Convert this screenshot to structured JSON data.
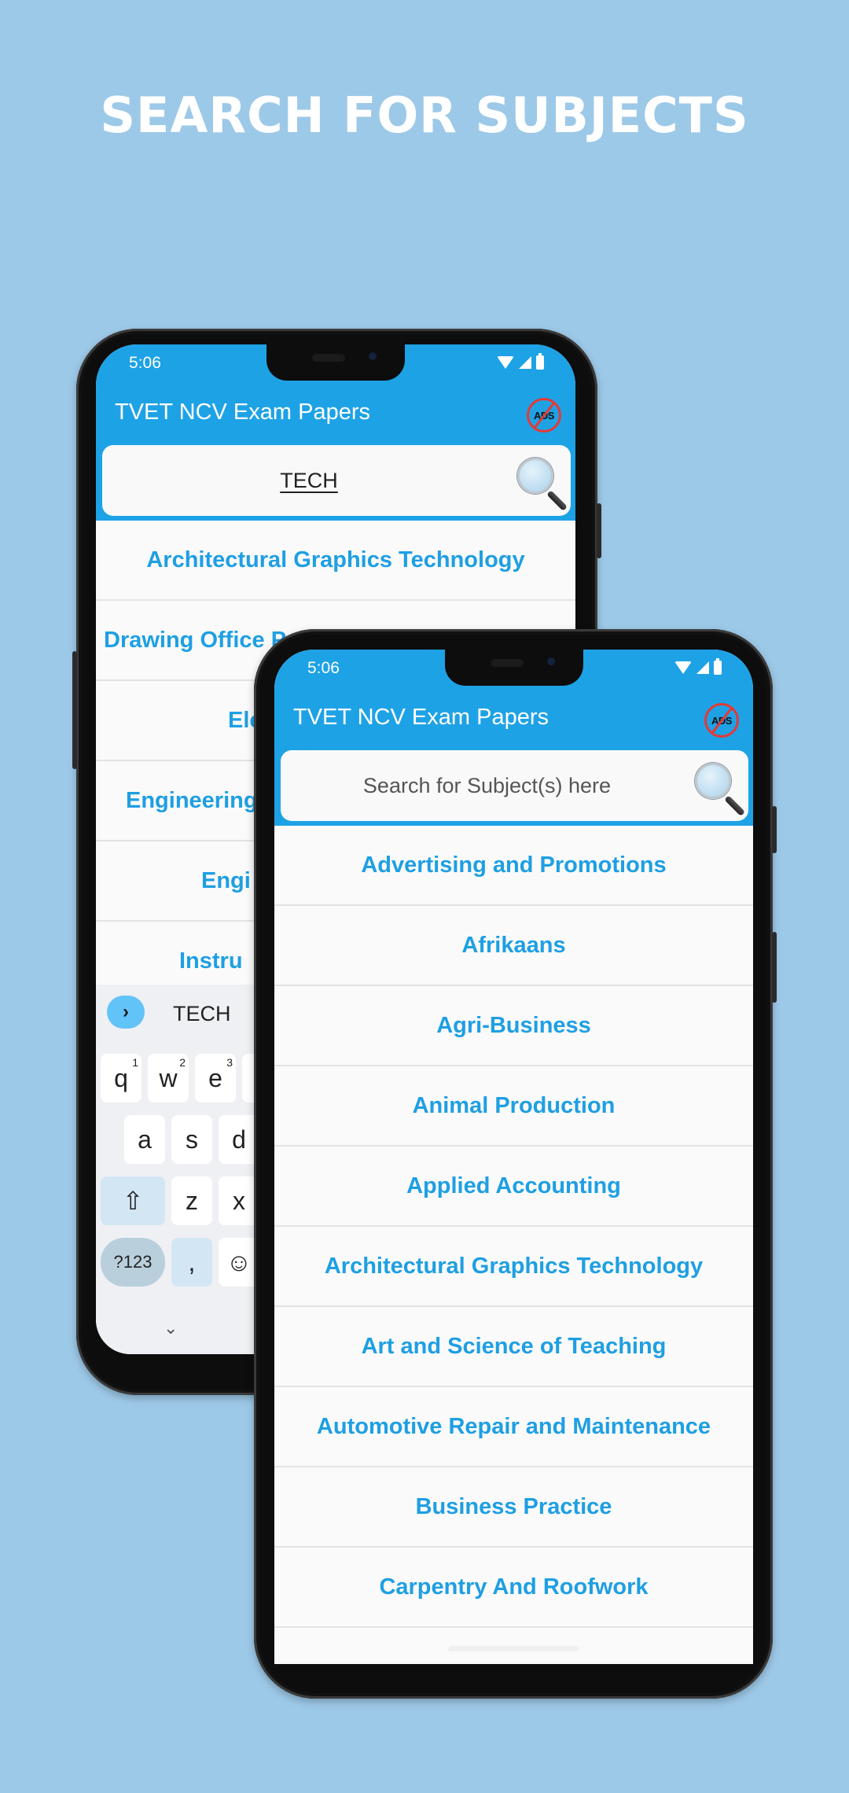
{
  "headline": "SEARCH FOR SUBJECTS",
  "colors": {
    "background": "#9dc9e8",
    "app_bar": "#1ea2e6",
    "list_text": "#1e9fe3",
    "no_ads_ring": "#e53935"
  },
  "back_phone": {
    "status": {
      "time": "5:06",
      "icons": [
        "wifi-icon",
        "signal-icon",
        "battery-icon"
      ]
    },
    "app_title": "TVET NCV Exam Papers",
    "no_ads_label": "ADS",
    "search": {
      "value": "TECH",
      "placeholder": "Search for Subject(s) here"
    },
    "results": [
      "Architectural Graphics Technology",
      "Drawing Office P",
      "Ele",
      "Engineering",
      "Engi",
      "Instru"
    ],
    "keyboard": {
      "suggestion": "TECH",
      "row1": [
        {
          "k": "q",
          "n": "1"
        },
        {
          "k": "w",
          "n": "2"
        },
        {
          "k": "e",
          "n": "3"
        }
      ],
      "row2": [
        "a",
        "s",
        "d"
      ],
      "row3": [
        "z",
        "x"
      ],
      "symbols_label": "?123",
      "comma_label": ",",
      "expand_glyph": "›",
      "hide_glyph": "⌄",
      "shift_glyph": "⇧",
      "emoji_glyph": "☺"
    }
  },
  "front_phone": {
    "status": {
      "time": "5:06",
      "icons": [
        "wifi-icon",
        "signal-icon",
        "battery-icon"
      ]
    },
    "app_title": "TVET NCV Exam Papers",
    "no_ads_label": "ADS",
    "search": {
      "value": "",
      "placeholder": "Search for Subject(s) here"
    },
    "subjects": [
      "Advertising and Promotions",
      "Afrikaans",
      "Agri-Business",
      "Animal Production",
      "Applied Accounting",
      "Architectural Graphics Technology",
      "Art and Science of Teaching",
      "Automotive Repair and Maintenance",
      "Business Practice",
      "Carpentry And Roofwork"
    ]
  }
}
